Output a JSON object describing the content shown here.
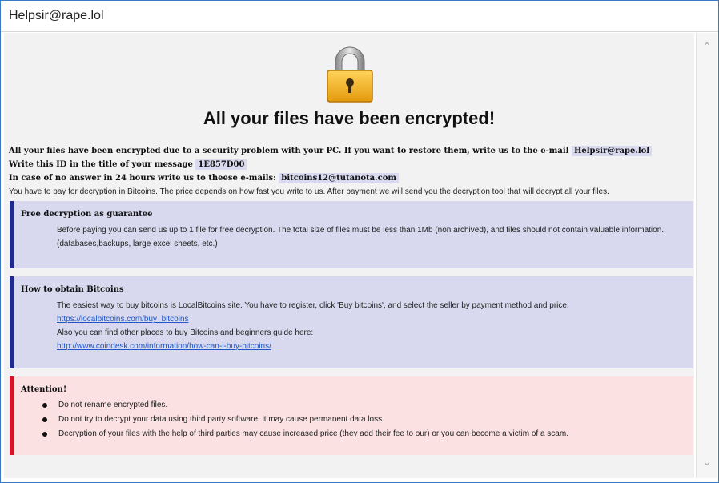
{
  "window": {
    "title": "Helpsir@rape.lol"
  },
  "headline": "All your files have been encrypted!",
  "intro": {
    "line1_text": "All your files have been encrypted due to a security problem with your PC. If you want to restore them, write us to the e-mail",
    "line1_email": "Helpsir@rape.lol",
    "line2_text": "Write this ID in the title of your message",
    "line2_id": "1E857D00",
    "line3_text": "In case of no answer in 24 hours write us to theese e-mails:",
    "line3_email": "bitcoins12@tutanota.com",
    "line4_text": "You have to pay for decryption in Bitcoins. The price depends on how fast you write to us. After payment we will send you the decryption tool that will decrypt all your files."
  },
  "free_decryption": {
    "title": "Free decryption as guarantee",
    "body": "Before paying you can send us up to 1 file for free decryption. The total size of files must be less than 1Mb (non archived), and files should not contain valuable information. (databases,backups, large excel sheets, etc.)"
  },
  "bitcoins": {
    "title": "How to obtain Bitcoins",
    "line1": "The easiest way to buy bitcoins is LocalBitcoins site. You have to register, click 'Buy bitcoins', and select the seller by payment method and price.",
    "link1": "https://localbitcoins.com/buy_bitcoins",
    "line2": "Also you can find other places to buy Bitcoins and beginners guide here:",
    "link2": "http://www.coindesk.com/information/how-can-i-buy-bitcoins/"
  },
  "attention": {
    "title": "Attention!",
    "items": [
      "Do not rename encrypted files.",
      "Do not try to decrypt your data using third party software, it may cause permanent data loss.",
      "Decryption of your files with the help of third parties may cause increased price (they add their fee to our) or you can become a victim of a scam."
    ]
  },
  "colors": {
    "blue_panel": "#d8d9ee",
    "blue_accent": "#1f2a8a",
    "red_panel": "#fbe1e1",
    "red_accent": "#d4142a",
    "link": "#1f57c6"
  },
  "icons": {
    "lock": "padlock-icon",
    "scroll_up": "chevron-up-icon",
    "scroll_down": "chevron-down-icon"
  }
}
